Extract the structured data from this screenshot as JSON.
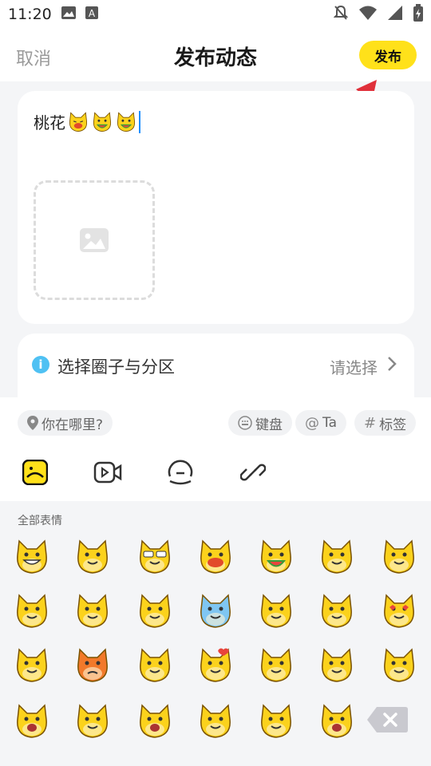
{
  "status_bar": {
    "time": "11:20",
    "icons": [
      "image-icon",
      "a-box-icon",
      "silent-icon",
      "wifi-icon",
      "signal-icon",
      "battery-charging-icon"
    ]
  },
  "header": {
    "cancel": "取消",
    "title": "发布动态",
    "publish": "发布"
  },
  "post": {
    "text": "桃花",
    "inline_emoji_count": 3
  },
  "circle": {
    "label": "选择圈子与分区",
    "placeholder": "请选择"
  },
  "toolbar": {
    "location": "你在哪里?",
    "keyboard": "键盘",
    "mention": "Ta",
    "tag": "标签"
  },
  "media_tabs": [
    "emoji-tab-icon",
    "video-icon",
    "sticker-face-icon",
    "link-icon"
  ],
  "emoji_panel": {
    "section_title": "全部表情"
  },
  "colors": {
    "accent_yellow": "#ffe11a",
    "arrow_red": "#e0303a",
    "cat_yellow": "#fbd21c",
    "cursor_blue": "#1e90ff"
  }
}
